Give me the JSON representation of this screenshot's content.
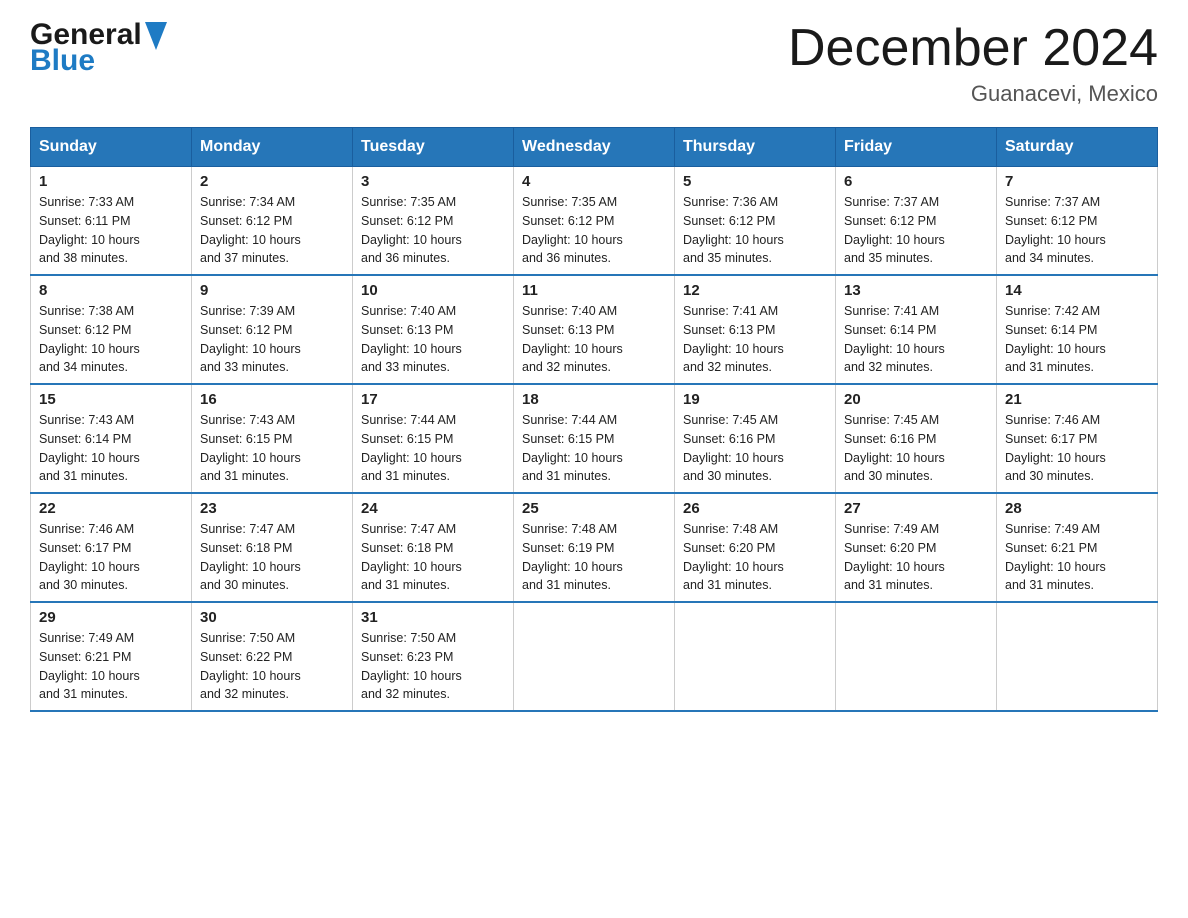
{
  "header": {
    "logo_general": "General",
    "logo_blue": "Blue",
    "title": "December 2024",
    "location": "Guanacevi, Mexico"
  },
  "days_of_week": [
    "Sunday",
    "Monday",
    "Tuesday",
    "Wednesday",
    "Thursday",
    "Friday",
    "Saturday"
  ],
  "weeks": [
    [
      {
        "day": "1",
        "sunrise": "7:33 AM",
        "sunset": "6:11 PM",
        "daylight": "10 hours and 38 minutes."
      },
      {
        "day": "2",
        "sunrise": "7:34 AM",
        "sunset": "6:12 PM",
        "daylight": "10 hours and 37 minutes."
      },
      {
        "day": "3",
        "sunrise": "7:35 AM",
        "sunset": "6:12 PM",
        "daylight": "10 hours and 36 minutes."
      },
      {
        "day": "4",
        "sunrise": "7:35 AM",
        "sunset": "6:12 PM",
        "daylight": "10 hours and 36 minutes."
      },
      {
        "day": "5",
        "sunrise": "7:36 AM",
        "sunset": "6:12 PM",
        "daylight": "10 hours and 35 minutes."
      },
      {
        "day": "6",
        "sunrise": "7:37 AM",
        "sunset": "6:12 PM",
        "daylight": "10 hours and 35 minutes."
      },
      {
        "day": "7",
        "sunrise": "7:37 AM",
        "sunset": "6:12 PM",
        "daylight": "10 hours and 34 minutes."
      }
    ],
    [
      {
        "day": "8",
        "sunrise": "7:38 AM",
        "sunset": "6:12 PM",
        "daylight": "10 hours and 34 minutes."
      },
      {
        "day": "9",
        "sunrise": "7:39 AM",
        "sunset": "6:12 PM",
        "daylight": "10 hours and 33 minutes."
      },
      {
        "day": "10",
        "sunrise": "7:40 AM",
        "sunset": "6:13 PM",
        "daylight": "10 hours and 33 minutes."
      },
      {
        "day": "11",
        "sunrise": "7:40 AM",
        "sunset": "6:13 PM",
        "daylight": "10 hours and 32 minutes."
      },
      {
        "day": "12",
        "sunrise": "7:41 AM",
        "sunset": "6:13 PM",
        "daylight": "10 hours and 32 minutes."
      },
      {
        "day": "13",
        "sunrise": "7:41 AM",
        "sunset": "6:14 PM",
        "daylight": "10 hours and 32 minutes."
      },
      {
        "day": "14",
        "sunrise": "7:42 AM",
        "sunset": "6:14 PM",
        "daylight": "10 hours and 31 minutes."
      }
    ],
    [
      {
        "day": "15",
        "sunrise": "7:43 AM",
        "sunset": "6:14 PM",
        "daylight": "10 hours and 31 minutes."
      },
      {
        "day": "16",
        "sunrise": "7:43 AM",
        "sunset": "6:15 PM",
        "daylight": "10 hours and 31 minutes."
      },
      {
        "day": "17",
        "sunrise": "7:44 AM",
        "sunset": "6:15 PM",
        "daylight": "10 hours and 31 minutes."
      },
      {
        "day": "18",
        "sunrise": "7:44 AM",
        "sunset": "6:15 PM",
        "daylight": "10 hours and 31 minutes."
      },
      {
        "day": "19",
        "sunrise": "7:45 AM",
        "sunset": "6:16 PM",
        "daylight": "10 hours and 30 minutes."
      },
      {
        "day": "20",
        "sunrise": "7:45 AM",
        "sunset": "6:16 PM",
        "daylight": "10 hours and 30 minutes."
      },
      {
        "day": "21",
        "sunrise": "7:46 AM",
        "sunset": "6:17 PM",
        "daylight": "10 hours and 30 minutes."
      }
    ],
    [
      {
        "day": "22",
        "sunrise": "7:46 AM",
        "sunset": "6:17 PM",
        "daylight": "10 hours and 30 minutes."
      },
      {
        "day": "23",
        "sunrise": "7:47 AM",
        "sunset": "6:18 PM",
        "daylight": "10 hours and 30 minutes."
      },
      {
        "day": "24",
        "sunrise": "7:47 AM",
        "sunset": "6:18 PM",
        "daylight": "10 hours and 31 minutes."
      },
      {
        "day": "25",
        "sunrise": "7:48 AM",
        "sunset": "6:19 PM",
        "daylight": "10 hours and 31 minutes."
      },
      {
        "day": "26",
        "sunrise": "7:48 AM",
        "sunset": "6:20 PM",
        "daylight": "10 hours and 31 minutes."
      },
      {
        "day": "27",
        "sunrise": "7:49 AM",
        "sunset": "6:20 PM",
        "daylight": "10 hours and 31 minutes."
      },
      {
        "day": "28",
        "sunrise": "7:49 AM",
        "sunset": "6:21 PM",
        "daylight": "10 hours and 31 minutes."
      }
    ],
    [
      {
        "day": "29",
        "sunrise": "7:49 AM",
        "sunset": "6:21 PM",
        "daylight": "10 hours and 31 minutes."
      },
      {
        "day": "30",
        "sunrise": "7:50 AM",
        "sunset": "6:22 PM",
        "daylight": "10 hours and 32 minutes."
      },
      {
        "day": "31",
        "sunrise": "7:50 AM",
        "sunset": "6:23 PM",
        "daylight": "10 hours and 32 minutes."
      },
      null,
      null,
      null,
      null
    ]
  ],
  "labels": {
    "sunrise": "Sunrise:",
    "sunset": "Sunset:",
    "daylight": "Daylight:"
  }
}
